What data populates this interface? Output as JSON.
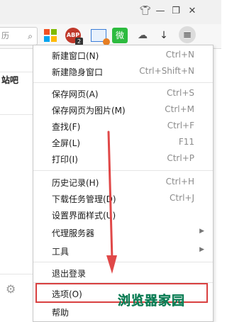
{
  "toolbar": {
    "address_fragment": "历",
    "abp_label": "ABP",
    "abp_badge": "2",
    "wechat_glyph": "微"
  },
  "page": {
    "left_text": "站吧"
  },
  "menu": {
    "items": [
      {
        "label": "新建窗口(N)",
        "shortcut": "Ctrl+N"
      },
      {
        "label": "新建隐身窗口",
        "shortcut": "Ctrl+Shift+N"
      },
      {
        "label": "保存网页(A)",
        "shortcut": "Ctrl+S"
      },
      {
        "label": "保存网页为图片(M)",
        "shortcut": "Ctrl+M"
      },
      {
        "label": "查找(F)",
        "shortcut": "Ctrl+F"
      },
      {
        "label": "全屏(L)",
        "shortcut": "F11"
      },
      {
        "label": "打印(I)",
        "shortcut": "Ctrl+P"
      },
      {
        "label": "历史记录(H)",
        "shortcut": "Ctrl+H"
      },
      {
        "label": "下载任务管理(D)",
        "shortcut": "Ctrl+J"
      },
      {
        "label": "设置界面样式(U)",
        "shortcut": ""
      },
      {
        "label": "代理服务器",
        "shortcut": ""
      },
      {
        "label": "工具",
        "shortcut": ""
      },
      {
        "label": "退出登录",
        "shortcut": ""
      },
      {
        "label": "选项(O)",
        "shortcut": ""
      },
      {
        "label": "帮助",
        "shortcut": ""
      }
    ],
    "highlighted_item": "选项(O)"
  },
  "annotation": {
    "watermark": "浏览器家园",
    "highlight_color": "#d94040",
    "arrow_color": "#e04848",
    "watermark_color": "#19a974"
  }
}
